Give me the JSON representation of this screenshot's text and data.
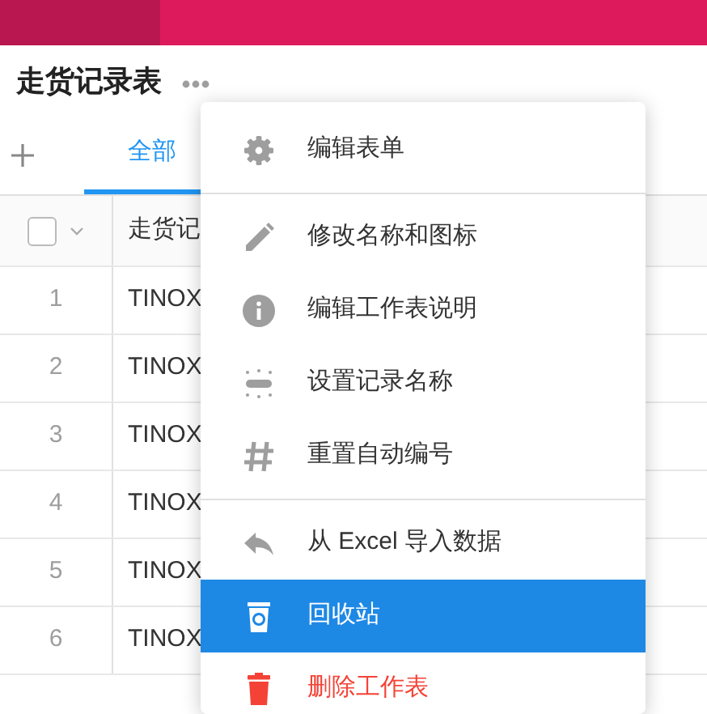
{
  "sheet": {
    "title": "走货记录表"
  },
  "tabs": [
    {
      "label": "全部",
      "selected": true
    }
  ],
  "table": {
    "header_checkbox": {
      "checked": false
    },
    "columns": [
      "走货记"
    ],
    "rows": [
      {
        "number": "1",
        "cells": [
          "TINOX"
        ]
      },
      {
        "number": "2",
        "cells": [
          "TINOX"
        ]
      },
      {
        "number": "3",
        "cells": [
          "TINOX"
        ]
      },
      {
        "number": "4",
        "cells": [
          "TINOX"
        ]
      },
      {
        "number": "5",
        "cells": [
          "TINOX"
        ]
      },
      {
        "number": "6",
        "cells": [
          "TINOX"
        ]
      }
    ]
  },
  "menu": {
    "sections": [
      [
        {
          "label": "编辑表单",
          "kind": "normal",
          "selected": false
        }
      ],
      [
        {
          "label": "修改名称和图标",
          "kind": "normal",
          "selected": false
        },
        {
          "label": "编辑工作表说明",
          "kind": "normal",
          "selected": false
        },
        {
          "label": "设置记录名称",
          "kind": "normal",
          "selected": false
        },
        {
          "label": "重置自动编号",
          "kind": "normal",
          "selected": false
        }
      ],
      [
        {
          "label": "从 Excel 导入数据",
          "kind": "normal",
          "selected": false
        },
        {
          "label": "回收站",
          "kind": "normal",
          "selected": true
        },
        {
          "label": "删除工作表",
          "kind": "danger",
          "selected": false
        }
      ]
    ]
  }
}
